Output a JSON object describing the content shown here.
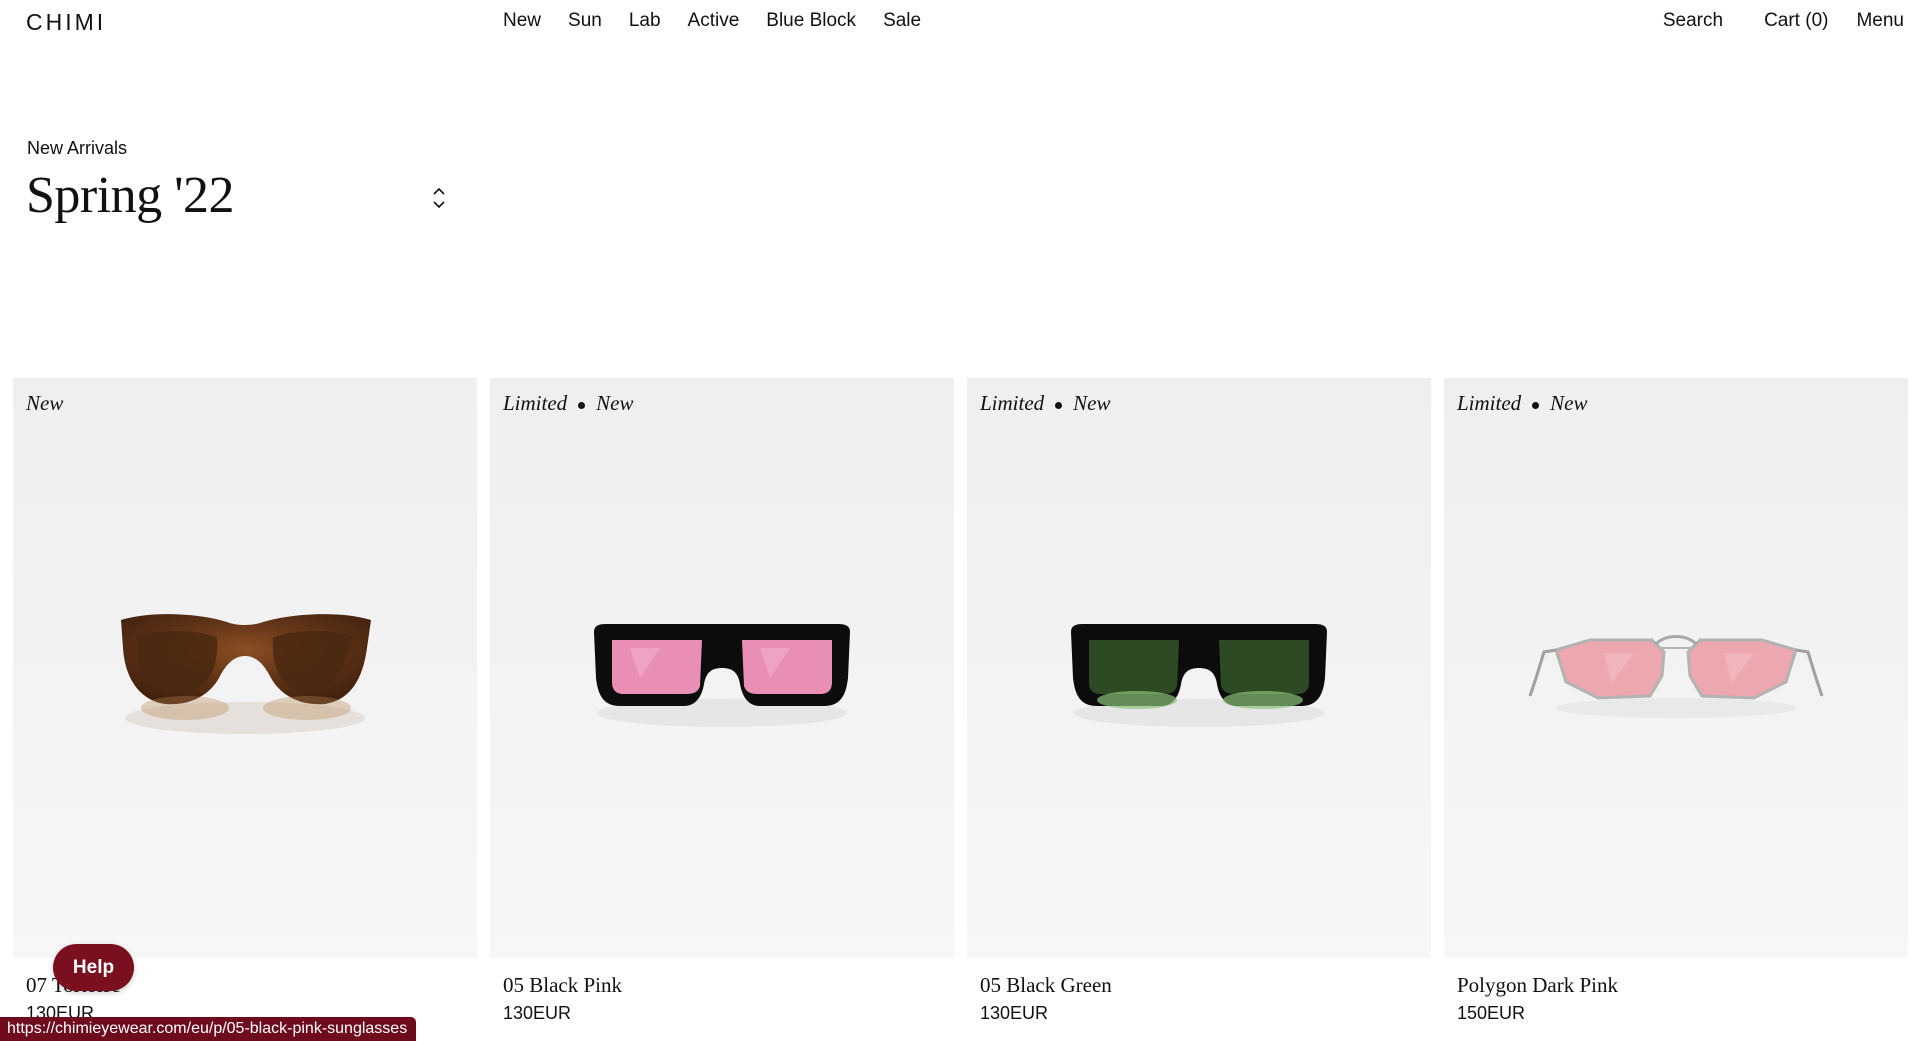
{
  "header": {
    "logo": "CHIMI",
    "nav": [
      "New",
      "Sun",
      "Lab",
      "Active",
      "Blue Block",
      "Sale"
    ],
    "search_label": "Search",
    "cart_label": "Cart (0)",
    "menu_label": "Menu"
  },
  "collection": {
    "eyebrow": "New Arrivals",
    "title": "Spring '22"
  },
  "products": [
    {
      "badges": [
        "New"
      ],
      "name": "07 Tortoise",
      "price": "130EUR",
      "frame_color": "#6b3a1c",
      "lens_color": "#4a2a14",
      "style": "wayfarer"
    },
    {
      "badges": [
        "Limited",
        "New"
      ],
      "name": "05 Black Pink",
      "price": "130EUR",
      "frame_color": "#0c0c0c",
      "lens_color": "#e98fb6",
      "style": "rectangle"
    },
    {
      "badges": [
        "Limited",
        "New"
      ],
      "name": "05 Black Green",
      "price": "130EUR",
      "frame_color": "#0c0c0c",
      "lens_color": "#7fa86a",
      "style": "rectangle"
    },
    {
      "badges": [
        "Limited",
        "New"
      ],
      "name": "Polygon Dark Pink",
      "price": "150EUR",
      "frame_color": "#b0b0b0",
      "lens_color": "#e8909a",
      "style": "wire"
    }
  ],
  "help_label": "Help",
  "status_url": "https://chimieyewear.com/eu/p/05-black-pink-sunglasses",
  "colors": {
    "help_bg": "#7a0f1f",
    "status_bg": "#6e0b1c"
  }
}
